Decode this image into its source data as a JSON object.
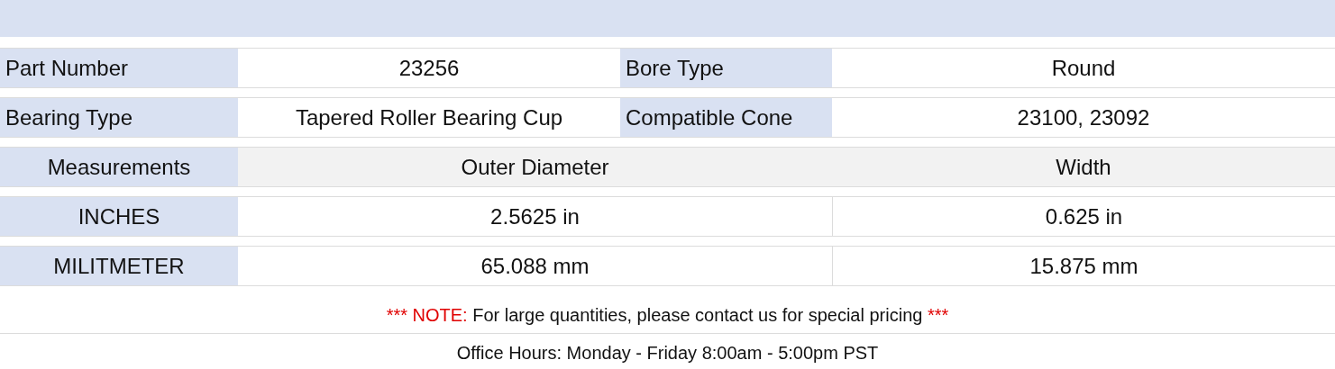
{
  "spec_rows": [
    {
      "label": "Part Number",
      "value": "23256",
      "label_2": "Bore Type",
      "value_2": "Round"
    },
    {
      "label": "Bearing Type",
      "value": "Tapered Roller Bearing Cup",
      "label_2": "Compatible Cone",
      "value_2": "23100, 23092"
    }
  ],
  "measurements": {
    "header": {
      "label": "Measurements",
      "column_1": "Outer Diameter",
      "column_2": "Width"
    },
    "rows": [
      {
        "label": "INCHES",
        "column_1": "2.5625 in",
        "column_2": "0.625 in"
      },
      {
        "label": "MILITMETER",
        "column_1": "65.088 mm",
        "column_2": "15.875 mm"
      }
    ]
  },
  "note": {
    "parts": [
      {
        "kind": "alert",
        "text": "*** NOTE:"
      },
      {
        "kind": "plain",
        "text": "For large quantities, please contact us for special pricing"
      },
      {
        "kind": "alert",
        "text": "***"
      }
    ]
  },
  "office_hours": "Office Hours: Monday - Friday 8:00am - 5:00pm PST"
}
